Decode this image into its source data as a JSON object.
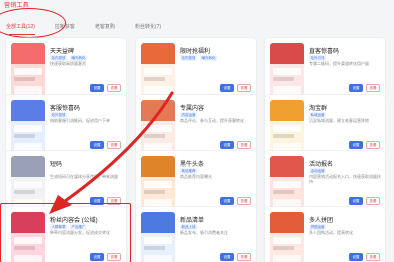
{
  "header": {
    "title": "营销工具"
  },
  "tabs": [
    {
      "label": "全部工具(12)"
    },
    {
      "label": "拉新获客"
    },
    {
      "label": "老客复购"
    },
    {
      "label": "粉丝转化(7)"
    }
  ],
  "cards": [
    {
      "title": "天天益碑",
      "tags": [
        "站内投放",
        "曝光转化"
      ],
      "description": "快速获取高质量客资",
      "set_label": "设置",
      "view_label": "查看",
      "colors": [
        "#ffd9d6",
        "#f56c6c"
      ]
    },
    {
      "title": "限时抢福利",
      "tags": [
        "站内投放",
        "曝光转化"
      ],
      "description": "",
      "set_label": "设置",
      "view_label": "查看",
      "colors": [
        "#fff1e6",
        "#e86a3a"
      ]
    },
    {
      "title": "直客惊喜码",
      "tags": [
        "站外引流"
      ],
      "description": "专属二维码，提升渠道转化用户量",
      "set_label": "设置",
      "view_label": "查看",
      "colors": [
        "#ffe6e6",
        "#d94a4a"
      ]
    },
    {
      "title": "客服惊喜码",
      "tags": [
        "站外投放"
      ],
      "description": "借助客服引流推码，促进用户下单",
      "set_label": "设置",
      "view_label": "查看",
      "colors": [
        "#e6efff",
        "#5a7ee6"
      ]
    },
    {
      "title": "专属内容",
      "tags": [
        "内容运营"
      ],
      "description": "商品评论、参与互动，提升获客转化",
      "set_label": "设置",
      "view_label": "查看",
      "colors": [
        "#fdebe6",
        "#e37a55"
      ]
    },
    {
      "title": "淘宝群",
      "tags": [
        "私域运营"
      ],
      "description": "沉淀私域流量，建立老客运营阵地",
      "set_label": "设置",
      "view_label": "查看",
      "colors": [
        "#fff4e0",
        "#f0a030"
      ]
    },
    {
      "title": "短码",
      "tags": [],
      "description": "生成短码可在媒体分享传播，带来流量",
      "set_label": "设置",
      "view_label": "查看",
      "colors": [
        "#f2f2f5",
        "#9aa0b5"
      ]
    },
    {
      "title": "黑牛头条",
      "tags": [
        "商品推荐"
      ],
      "description": "商品推荐内容曝光",
      "set_label": "设置",
      "view_label": "查看",
      "colors": [
        "#ffe9d6",
        "#e0842a"
      ]
    },
    {
      "title": "活动报名",
      "tags": [
        "活动运营"
      ],
      "description": "内容营销活动报名入口，快速获取流量扶持",
      "set_label": "设置",
      "view_label": "查看",
      "colors": [
        "#ffe3e0",
        "#e2574c"
      ]
    },
    {
      "title": "粉丝内容会 (公域)",
      "tags": [
        "人群种草",
        "产品推广"
      ],
      "description": "种草内容流量分发，促进成交转化",
      "set_label": "设置",
      "view_label": "查看",
      "colors": [
        "#ffd6dd",
        "#d8405a"
      ]
    },
    {
      "title": "新品清单",
      "tags": [
        "新品上线"
      ],
      "description": "新品发布，吸引消费者关注",
      "set_label": "设置",
      "view_label": "查看",
      "colors": [
        "#e8f0ff",
        "#4d7ae0"
      ]
    },
    {
      "title": "多人拼团",
      "tags": [
        "拼团运营"
      ],
      "description": "多人团购活动，提高转化",
      "set_label": "设置",
      "view_label": "查看",
      "colors": [
        "#ffe8e0",
        "#e35d3a"
      ]
    }
  ],
  "annotation_color": "#e02424"
}
